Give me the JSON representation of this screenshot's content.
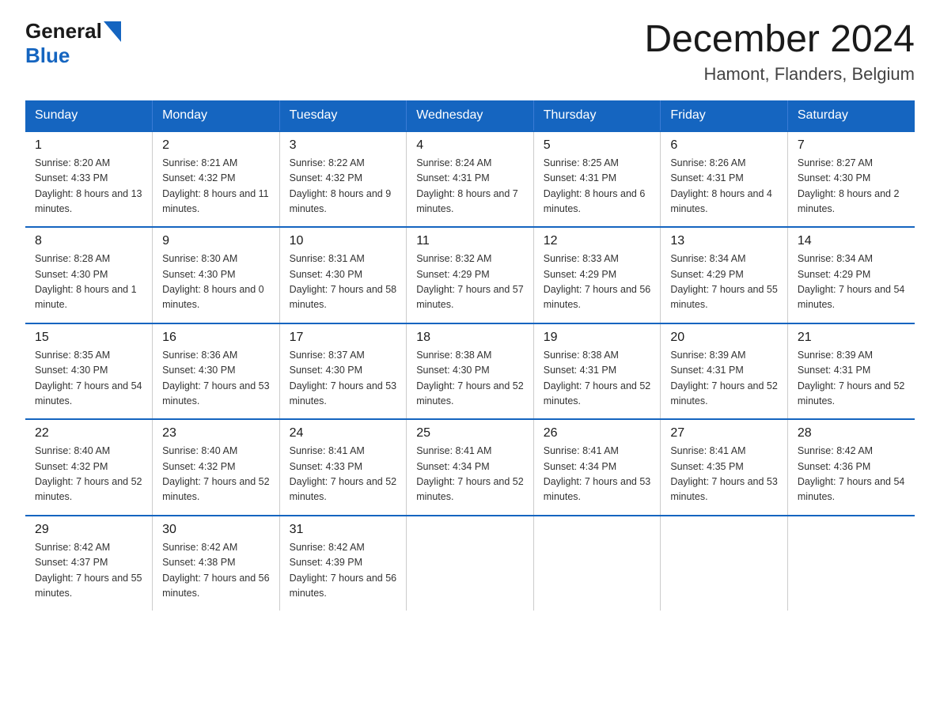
{
  "header": {
    "logo_general": "General",
    "logo_blue": "Blue",
    "month_title": "December 2024",
    "location": "Hamont, Flanders, Belgium"
  },
  "days_of_week": [
    "Sunday",
    "Monday",
    "Tuesday",
    "Wednesday",
    "Thursday",
    "Friday",
    "Saturday"
  ],
  "weeks": [
    [
      {
        "day": "1",
        "sunrise": "8:20 AM",
        "sunset": "4:33 PM",
        "daylight": "8 hours and 13 minutes."
      },
      {
        "day": "2",
        "sunrise": "8:21 AM",
        "sunset": "4:32 PM",
        "daylight": "8 hours and 11 minutes."
      },
      {
        "day": "3",
        "sunrise": "8:22 AM",
        "sunset": "4:32 PM",
        "daylight": "8 hours and 9 minutes."
      },
      {
        "day": "4",
        "sunrise": "8:24 AM",
        "sunset": "4:31 PM",
        "daylight": "8 hours and 7 minutes."
      },
      {
        "day": "5",
        "sunrise": "8:25 AM",
        "sunset": "4:31 PM",
        "daylight": "8 hours and 6 minutes."
      },
      {
        "day": "6",
        "sunrise": "8:26 AM",
        "sunset": "4:31 PM",
        "daylight": "8 hours and 4 minutes."
      },
      {
        "day": "7",
        "sunrise": "8:27 AM",
        "sunset": "4:30 PM",
        "daylight": "8 hours and 2 minutes."
      }
    ],
    [
      {
        "day": "8",
        "sunrise": "8:28 AM",
        "sunset": "4:30 PM",
        "daylight": "8 hours and 1 minute."
      },
      {
        "day": "9",
        "sunrise": "8:30 AM",
        "sunset": "4:30 PM",
        "daylight": "8 hours and 0 minutes."
      },
      {
        "day": "10",
        "sunrise": "8:31 AM",
        "sunset": "4:30 PM",
        "daylight": "7 hours and 58 minutes."
      },
      {
        "day": "11",
        "sunrise": "8:32 AM",
        "sunset": "4:29 PM",
        "daylight": "7 hours and 57 minutes."
      },
      {
        "day": "12",
        "sunrise": "8:33 AM",
        "sunset": "4:29 PM",
        "daylight": "7 hours and 56 minutes."
      },
      {
        "day": "13",
        "sunrise": "8:34 AM",
        "sunset": "4:29 PM",
        "daylight": "7 hours and 55 minutes."
      },
      {
        "day": "14",
        "sunrise": "8:34 AM",
        "sunset": "4:29 PM",
        "daylight": "7 hours and 54 minutes."
      }
    ],
    [
      {
        "day": "15",
        "sunrise": "8:35 AM",
        "sunset": "4:30 PM",
        "daylight": "7 hours and 54 minutes."
      },
      {
        "day": "16",
        "sunrise": "8:36 AM",
        "sunset": "4:30 PM",
        "daylight": "7 hours and 53 minutes."
      },
      {
        "day": "17",
        "sunrise": "8:37 AM",
        "sunset": "4:30 PM",
        "daylight": "7 hours and 53 minutes."
      },
      {
        "day": "18",
        "sunrise": "8:38 AM",
        "sunset": "4:30 PM",
        "daylight": "7 hours and 52 minutes."
      },
      {
        "day": "19",
        "sunrise": "8:38 AM",
        "sunset": "4:31 PM",
        "daylight": "7 hours and 52 minutes."
      },
      {
        "day": "20",
        "sunrise": "8:39 AM",
        "sunset": "4:31 PM",
        "daylight": "7 hours and 52 minutes."
      },
      {
        "day": "21",
        "sunrise": "8:39 AM",
        "sunset": "4:31 PM",
        "daylight": "7 hours and 52 minutes."
      }
    ],
    [
      {
        "day": "22",
        "sunrise": "8:40 AM",
        "sunset": "4:32 PM",
        "daylight": "7 hours and 52 minutes."
      },
      {
        "day": "23",
        "sunrise": "8:40 AM",
        "sunset": "4:32 PM",
        "daylight": "7 hours and 52 minutes."
      },
      {
        "day": "24",
        "sunrise": "8:41 AM",
        "sunset": "4:33 PM",
        "daylight": "7 hours and 52 minutes."
      },
      {
        "day": "25",
        "sunrise": "8:41 AM",
        "sunset": "4:34 PM",
        "daylight": "7 hours and 52 minutes."
      },
      {
        "day": "26",
        "sunrise": "8:41 AM",
        "sunset": "4:34 PM",
        "daylight": "7 hours and 53 minutes."
      },
      {
        "day": "27",
        "sunrise": "8:41 AM",
        "sunset": "4:35 PM",
        "daylight": "7 hours and 53 minutes."
      },
      {
        "day": "28",
        "sunrise": "8:42 AM",
        "sunset": "4:36 PM",
        "daylight": "7 hours and 54 minutes."
      }
    ],
    [
      {
        "day": "29",
        "sunrise": "8:42 AM",
        "sunset": "4:37 PM",
        "daylight": "7 hours and 55 minutes."
      },
      {
        "day": "30",
        "sunrise": "8:42 AM",
        "sunset": "4:38 PM",
        "daylight": "7 hours and 56 minutes."
      },
      {
        "day": "31",
        "sunrise": "8:42 AM",
        "sunset": "4:39 PM",
        "daylight": "7 hours and 56 minutes."
      },
      null,
      null,
      null,
      null
    ]
  ]
}
